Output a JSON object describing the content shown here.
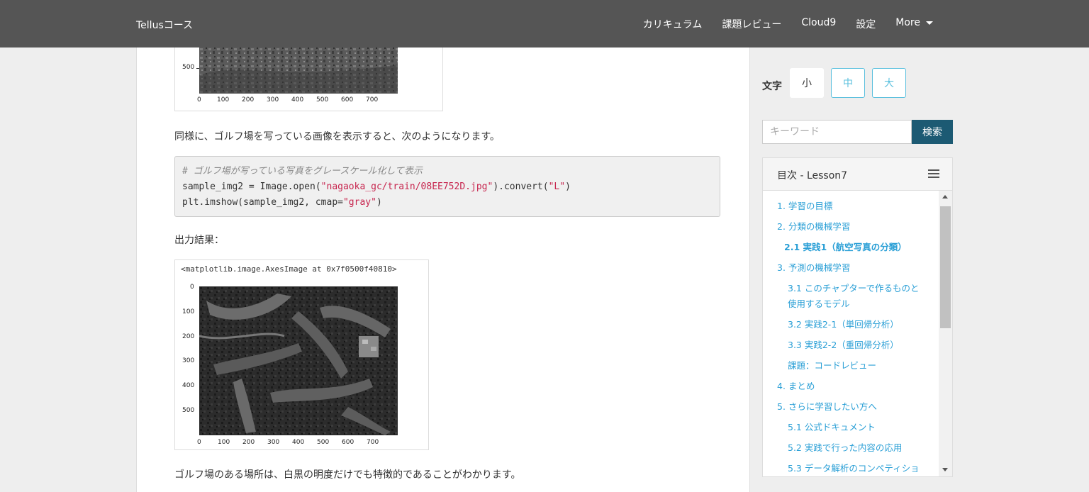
{
  "navbar": {
    "brand": "Tellusコース",
    "items": [
      "カリキュラム",
      "課題レビュー",
      "Cloud9",
      "設定",
      "More"
    ]
  },
  "figure_top": {
    "y_ticks": [
      "500"
    ],
    "x_ticks": [
      "0",
      "100",
      "200",
      "300",
      "400",
      "500",
      "600",
      "700"
    ]
  },
  "paragraph1": "同様に、ゴルフ場を写っている画像を表示すると、次のようになります。",
  "code": {
    "comment": "# ゴルフ場が写っている写真をグレースケール化して表示",
    "line2_pre": "sample_img2 = Image.open(",
    "line2_str1": "\"nagaoka_gc/train/08EE752D.jpg\"",
    "line2_mid": ").convert(",
    "line2_str2": "\"L\"",
    "line2_post": ")",
    "line3_pre": "plt.imshow(sample_img2, cmap=",
    "line3_str": "\"gray\"",
    "line3_post": ")"
  },
  "output_label": "出力結果：",
  "figure_output": {
    "repr": "<matplotlib.image.AxesImage at 0x7f0500f40810>",
    "y_ticks": [
      "0",
      "100",
      "200",
      "300",
      "400",
      "500"
    ],
    "x_ticks": [
      "0",
      "100",
      "200",
      "300",
      "400",
      "500",
      "600",
      "700"
    ]
  },
  "paragraph2": "ゴルフ場のある場所は、白黒の明度だけでも特徴的であることがわかります。",
  "sidebar": {
    "font_label": "文字",
    "sizes": [
      "小",
      "中",
      "大"
    ],
    "active_size": "小",
    "search_placeholder": "キーワード",
    "search_button": "検索",
    "toc_title": "目次 - Lesson7",
    "toc": [
      "1. 学習の目標",
      "2. 分類の機械学習",
      "2.1 実践1（航空写真の分類）",
      "3. 予測の機械学習",
      "3.1 このチャプターで作るものと",
      "使用するモデル",
      "3.2 実践2-1（単回帰分析）",
      "3.3 実践2-2（重回帰分析）",
      "課題：コードレビュー",
      "4. まとめ",
      "5. さらに学習したい方へ",
      "5.1 公式ドキュメント",
      "5.2 実践で行った内容の応用",
      "5.3 データ解析のコンペティショ"
    ]
  }
}
